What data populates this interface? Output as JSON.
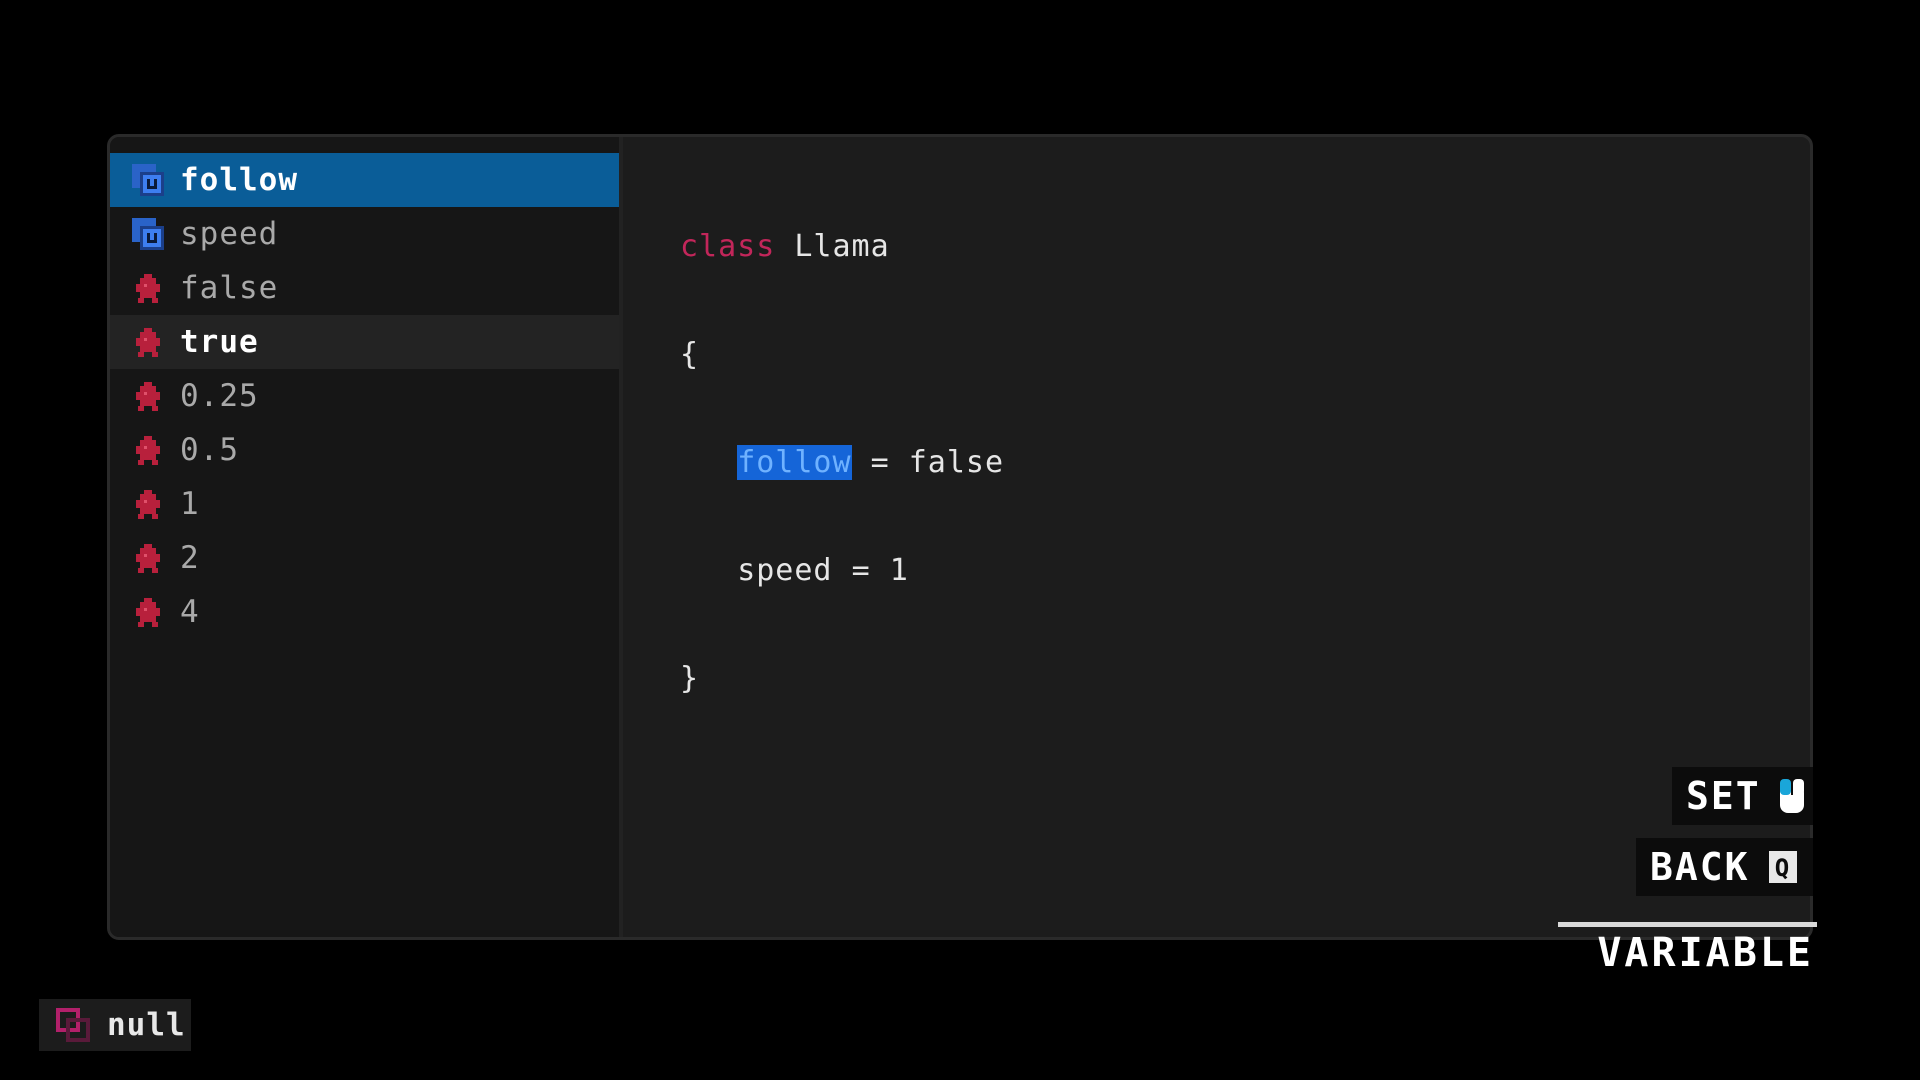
{
  "colors": {
    "background": "#000000",
    "panel": "#1c1c1c",
    "list_background": "#161616",
    "selected": "#0a5d98",
    "keyword": "#c2265a",
    "variable_icon": "#2a63c8",
    "value_icon": "#b8203c",
    "highlight": "#1565d8"
  },
  "list": {
    "items": [
      {
        "label": "follow",
        "icon": "variable-icon",
        "state": "selected"
      },
      {
        "label": "speed",
        "icon": "variable-icon",
        "state": "normal"
      },
      {
        "label": "false",
        "icon": "value-icon",
        "state": "normal"
      },
      {
        "label": "true",
        "icon": "value-icon",
        "state": "hovered"
      },
      {
        "label": "0.25",
        "icon": "value-icon",
        "state": "normal"
      },
      {
        "label": "0.5",
        "icon": "value-icon",
        "state": "normal"
      },
      {
        "label": "1",
        "icon": "value-icon",
        "state": "normal"
      },
      {
        "label": "2",
        "icon": "value-icon",
        "state": "normal"
      },
      {
        "label": "4",
        "icon": "value-icon",
        "state": "normal"
      }
    ]
  },
  "code": {
    "keyword": "class",
    "class_name": "Llama",
    "open_brace": "{",
    "close_brace": "}",
    "lines": [
      {
        "name": "follow",
        "op": "=",
        "value": "false"
      },
      {
        "name": "speed",
        "op": "=",
        "value": "1"
      }
    ]
  },
  "controls": {
    "set_label": "SET",
    "set_icon": "mouse-icon",
    "back_label": "BACK",
    "back_key": "Q",
    "back_icon": "key-q-icon"
  },
  "mode": {
    "label": "VARIABLE"
  },
  "status": {
    "label": "null",
    "icon": "null-icon"
  }
}
